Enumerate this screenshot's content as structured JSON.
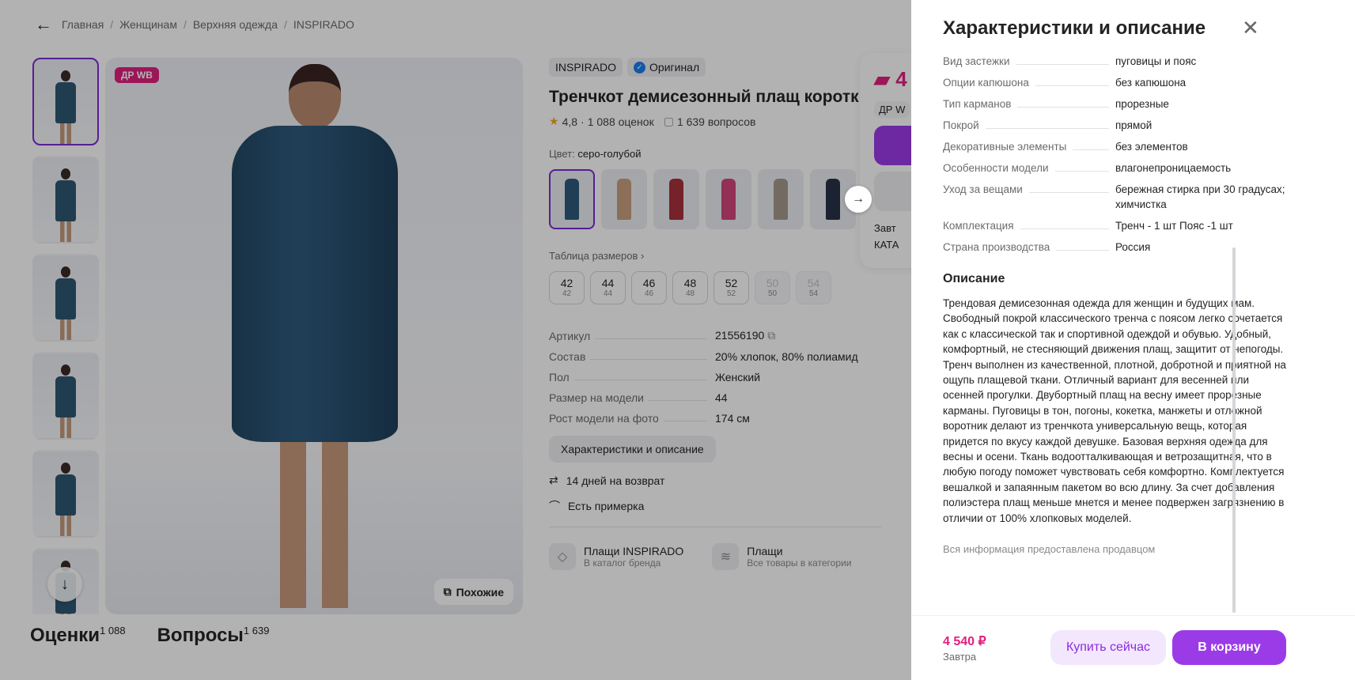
{
  "breadcrumb": [
    "Главная",
    "Женщинам",
    "Верхняя одежда",
    "INSPIRADO"
  ],
  "gallery": {
    "badge": "ДР WB",
    "similar_label": "Похожие"
  },
  "product": {
    "brand": "INSPIRADO",
    "original_label": "Оригинал",
    "title": "Тренчкот демисезонный плащ короткий",
    "rating": "4,8",
    "reviews_count": "1 088 оценок",
    "questions_count": "1 639 вопросов",
    "color_label": "Цвет:",
    "color_value": "серо-голубой",
    "size_table_label": "Таблица размеров",
    "sizes": [
      {
        "main": "42",
        "sub": "42",
        "available": true
      },
      {
        "main": "44",
        "sub": "44",
        "available": true
      },
      {
        "main": "46",
        "sub": "46",
        "available": true
      },
      {
        "main": "48",
        "sub": "48",
        "available": true
      },
      {
        "main": "52",
        "sub": "52",
        "available": true
      },
      {
        "main": "50",
        "sub": "50",
        "available": false
      },
      {
        "main": "54",
        "sub": "54",
        "available": false
      }
    ],
    "specs": [
      {
        "k": "Артикул",
        "v": "21556190"
      },
      {
        "k": "Состав",
        "v": "20% хлопок, 80% полиамид"
      },
      {
        "k": "Пол",
        "v": "Женский"
      },
      {
        "k": "Размер на модели",
        "v": "44"
      },
      {
        "k": "Рост модели на фото",
        "v": "174 см"
      }
    ],
    "char_button": "Характеристики и описание",
    "return_label": "14 дней на возврат",
    "fitting_label": "Есть примерка",
    "brand_link": {
      "title": "Плащи INSPIRADO",
      "sub": "В каталог бренда"
    },
    "category_link": {
      "title": "Плащи",
      "sub": "Все товары в категории"
    }
  },
  "buybox": {
    "price": "4",
    "wb_label": "ДР W",
    "delivery": "Завт",
    "catalog": "КАТА"
  },
  "tabs": {
    "reviews": "Оценки",
    "reviews_count": "1 088",
    "questions": "Вопросы",
    "questions_count": "1 639"
  },
  "drawer": {
    "title": "Характеристики и описание",
    "rows": [
      {
        "k": "Вид застежки",
        "v": "пуговицы и пояс"
      },
      {
        "k": "Опции капюшона",
        "v": "без капюшона"
      },
      {
        "k": "Тип карманов",
        "v": "прорезные"
      },
      {
        "k": "Покрой",
        "v": "прямой"
      },
      {
        "k": "Декоративные элементы",
        "v": "без элементов"
      },
      {
        "k": "Особенности модели",
        "v": "влагонепроницаемость"
      },
      {
        "k": "Уход за вещами",
        "v": "бережная стирка при 30 градусах; химчистка"
      },
      {
        "k": "Комплектация",
        "v": "Тренч - 1 шт Пояс -1 шт"
      },
      {
        "k": "Страна производства",
        "v": "Россия"
      }
    ],
    "description_title": "Описание",
    "description": "Трендовая демисезонная одежда для женщин и будущих мам. Свободный покрой классического тренча с поясом легко сочетается как с классической так и спортивной одеждой и обувью. Удобный, комфортный, не стесняющий движения плащ, защитит от непогоды. Тренч выполнен из качественной, плотной, добротной и приятной на ощупь плащевой ткани. Отличный вариант для весенней или осенней прогулки. Двубортный плащ на весну имеет прорезные карманы. Пуговицы в тон, погоны, кокетка, манжеты и отложной воротник делают из тренчкота универсальную вещь, которая придется по вкусу каждой девушке. Базовая верхняя одежда для весны и осени. Ткань водоотталкивающая и ветрозащитная, что в любую погоду поможет чувствовать себя комфортно. Комплектуется вешалкой и запаянным пакетом во всю длину. За счет добавления полиэстера плащ меньше мнется и менее подвержен загрязнению в отличии от 100% хлопковых моделей.",
    "seller_note": "Вся информация предоставлена продавцом",
    "footer": {
      "price": "4 540 ₽",
      "delivery": "Завтра",
      "buy_now": "Купить сейчас",
      "to_cart": "В корзину"
    }
  },
  "colors": {
    "accent": "#9b3be8",
    "price": "#e0207f",
    "coat": "#2f5b7d"
  }
}
